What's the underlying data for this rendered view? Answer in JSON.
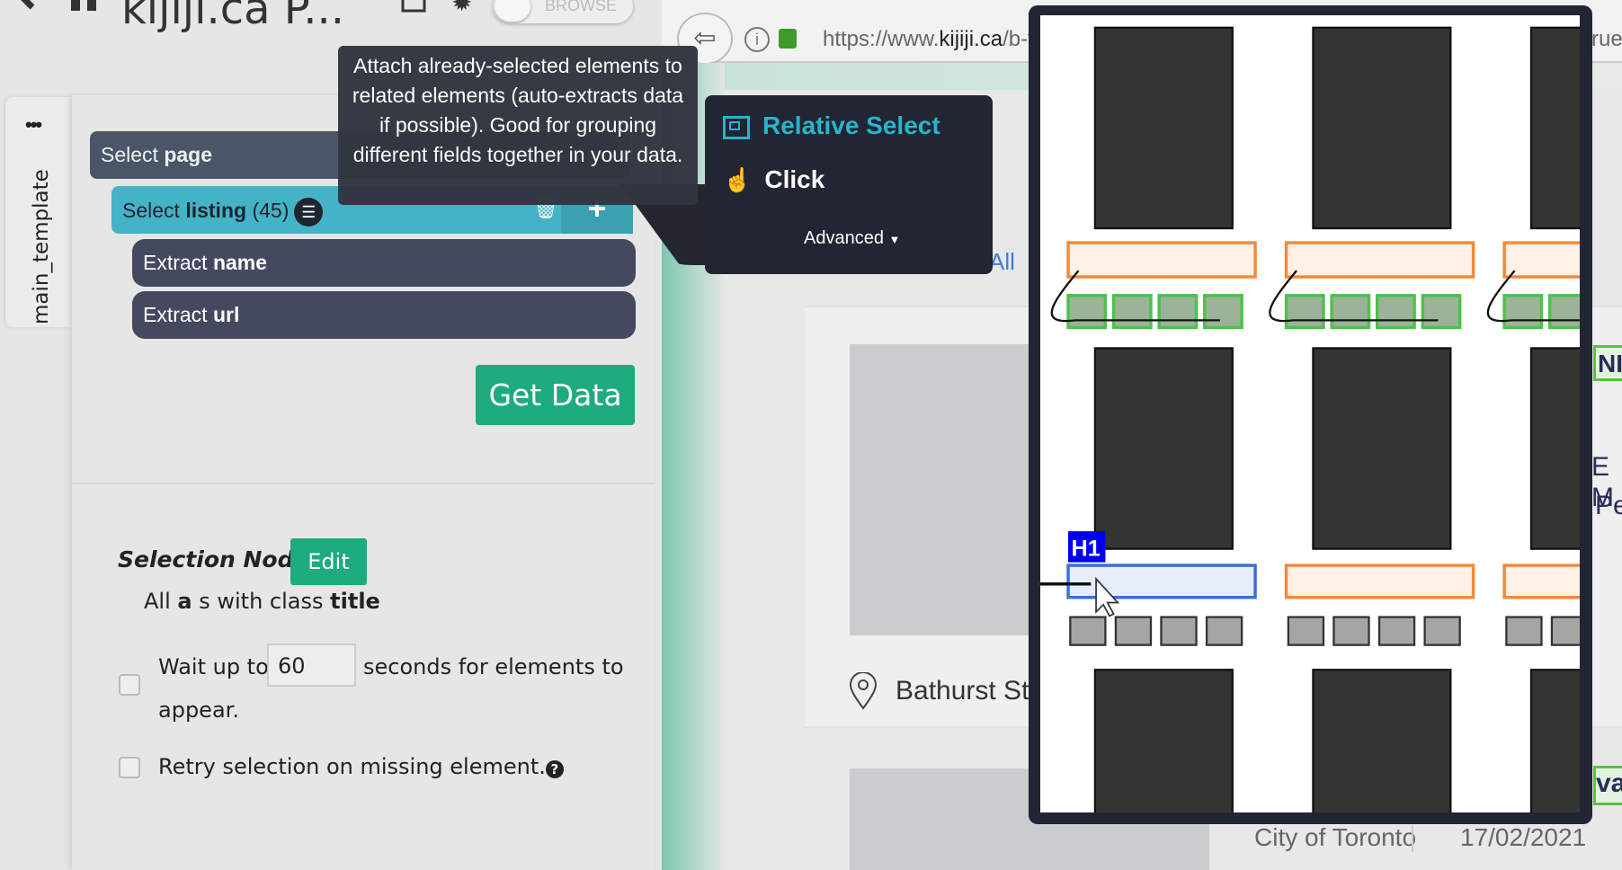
{
  "app": {
    "title": "kijiji.ca P...",
    "toggle_label": "BROWSE",
    "icons": [
      "back-arrow-icon",
      "home-icon",
      "save-icon",
      "gear-icon"
    ]
  },
  "sidebar_tab": {
    "label": "main_template",
    "menu": "•••"
  },
  "tree": {
    "select_page": {
      "verb": "Select",
      "name": "page"
    },
    "select_listing": {
      "verb": "Select",
      "name": "listing",
      "count": "(45)"
    },
    "extract_name": {
      "verb": "Extract",
      "name": "name"
    },
    "extract_url": {
      "verb": "Extract",
      "name": "url"
    }
  },
  "get_data_label": "Get Data",
  "selection": {
    "label": "Selection Node:",
    "edit_label": "Edit",
    "desc_prefix": "All",
    "desc_tag": "a",
    "desc_mid": "s with class",
    "desc_class": "title"
  },
  "wait": {
    "prefix": "Wait up to",
    "value": "60",
    "suffix": "seconds for elements to",
    "suffix2": "appear.",
    "checked": false
  },
  "retry": {
    "label": "Retry selection on missing element.",
    "checked": false
  },
  "tooltip": "Attach already-selected elements to related elements (auto-extracts data if possible). Good for grouping different fields together in your data.",
  "menu": {
    "items": [
      {
        "label": "Relative Select",
        "icon": "relative-select-icon",
        "active": true
      },
      {
        "label": "Click",
        "icon": "pointer-hand-icon"
      }
    ],
    "advanced": "Advanced"
  },
  "browser": {
    "url_host_pre": "https://www.",
    "url_host": "kijiji.ca",
    "url_path": "/b-f",
    "url_right": "rue"
  },
  "page": {
    "all_link": "All",
    "location": "Bathurst St",
    "city": "City of Toronto",
    "date": "17/02/2021",
    "edge_texts": [
      "NI",
      "E M",
      "Pe",
      "val"
    ]
  },
  "overlay": {
    "badge": "H1"
  },
  "colors": {
    "accent_teal": "#45b3c6",
    "green": "#1eab7e",
    "menu_bg": "#222532",
    "active_item": "#26b5cc"
  }
}
